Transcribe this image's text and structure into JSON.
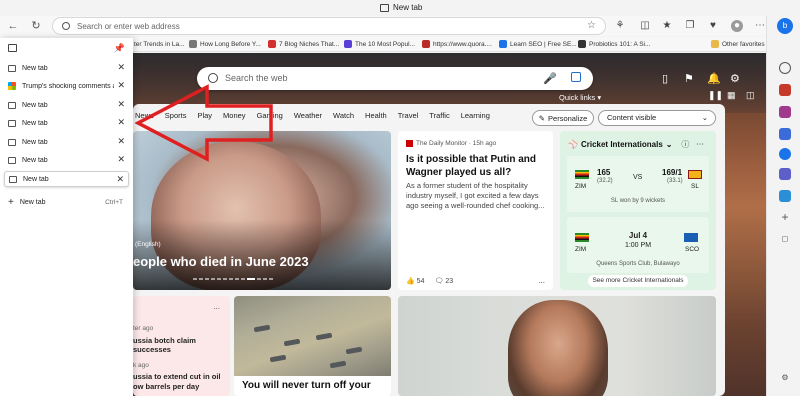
{
  "window": {
    "tab_title": "New tab"
  },
  "address_bar": {
    "placeholder": "Search or enter web address"
  },
  "favorites": [
    {
      "label": "ter Trends in La...",
      "color": "#7a4fd0"
    },
    {
      "label": "How Long Before Y...",
      "color": "#777777"
    },
    {
      "label": "7 Blog Niches That...",
      "color": "#d22f2f"
    },
    {
      "label": "The 10 Most Popul...",
      "color": "#5a3fd6"
    },
    {
      "label": "https://www.quora....",
      "color": "#b92b27"
    },
    {
      "label": "Learn SEO | Free SE...",
      "color": "#1a73e8"
    },
    {
      "label": "Probiotics 101: A Si...",
      "color": "#333333"
    },
    {
      "label": "Other favorites",
      "color": "#e8b84a"
    }
  ],
  "search": {
    "placeholder": "Search the web"
  },
  "quick_links": "Quick links",
  "nav_tabs": [
    "News",
    "Sports",
    "Play",
    "Money",
    "Gaming",
    "Weather",
    "Watch",
    "Health",
    "Travel",
    "Traffic",
    "Learning"
  ],
  "personalize_label": "Personalize",
  "content_visible_label": "Content visible",
  "hero": {
    "source": "(English)",
    "headline": "eople who died in June 2023"
  },
  "news_card": {
    "source": "The Daily Monitor · 15h ago",
    "title": "Is it possible that Putin and Wagner played us all?",
    "body": "As a former student of the hospitality industry myself, I got excited a few days ago seeing a well-rounded chef cooking...",
    "likes": "54",
    "comments": "23",
    "more": "..."
  },
  "cricket": {
    "title": "Cricket Internationals",
    "match1": {
      "team1": "ZIM",
      "team1_score": "165",
      "team1_overs": "(32.2)",
      "vs": "VS",
      "team2": "SL",
      "team2_score": "169/1",
      "team2_overs": "(33.1)",
      "result": "SL won by 9 wickets"
    },
    "match2": {
      "team1": "ZIM",
      "team2": "SCO",
      "date": "Jul 4",
      "time": "1:00 PM",
      "venue": "Queens Sports Club, Bulawayo"
    },
    "see_more": "See more Cricket Internationals"
  },
  "bottom_card1": {
    "more": "...",
    "time1": "ter ago",
    "headline1": "ussia botch claim successes",
    "time2": "k ago",
    "headline2": "ussia to extend cut in oil ow barrels per day"
  },
  "bottom_card2": {
    "caption": "You will never turn off your"
  },
  "vertical_tabs": {
    "tabs": [
      {
        "label": "New tab",
        "icon": "tab-icon"
      },
      {
        "label": "Trump's shocking comments abo",
        "icon": "microsoft-icon"
      },
      {
        "label": "New tab",
        "icon": "tab-icon"
      },
      {
        "label": "New tab",
        "icon": "tab-icon"
      },
      {
        "label": "New tab",
        "icon": "tab-icon"
      },
      {
        "label": "New tab",
        "icon": "tab-icon"
      },
      {
        "label": "New tab",
        "icon": "tab-icon"
      }
    ],
    "new_tab_label": "New tab",
    "new_tab_shortcut": "Ctrl+T",
    "close_glyph": "✕"
  }
}
